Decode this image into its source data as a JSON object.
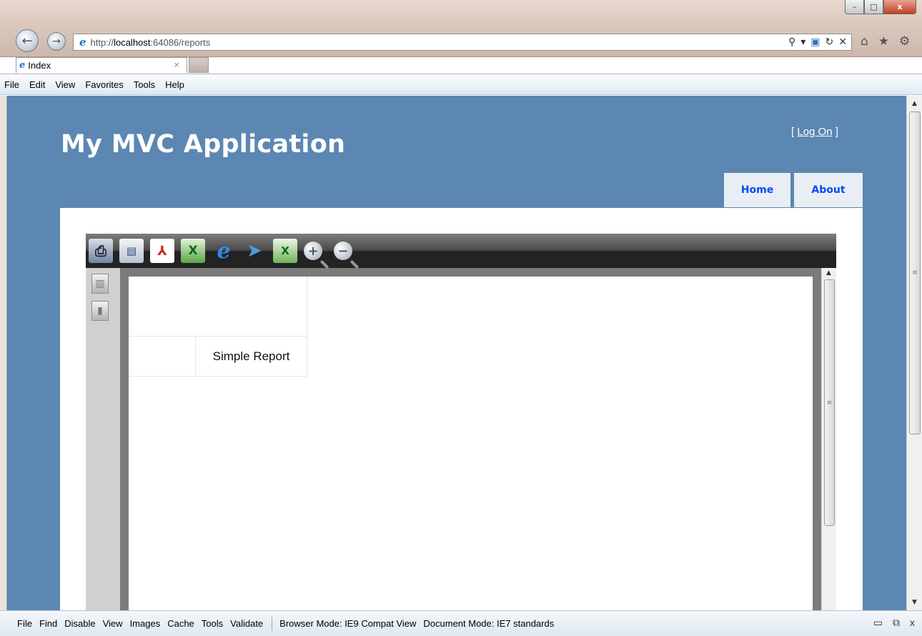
{
  "browser": {
    "url_prefix": "http://",
    "url_host": "localhost",
    "url_rest": ":64086/reports",
    "tab_title": "Index",
    "win_min": "–",
    "win_max": "□",
    "win_close": "x"
  },
  "menubar": {
    "items": [
      "File",
      "Edit",
      "View",
      "Favorites",
      "Tools",
      "Help"
    ]
  },
  "site": {
    "title": "My MVC Application",
    "logon_open": "[",
    "logon_label": "Log On",
    "logon_close": "]",
    "nav": [
      {
        "label": "Home"
      },
      {
        "label": "About"
      }
    ]
  },
  "report": {
    "title": "Simple Report",
    "toolbar_icons": [
      "print-icon",
      "document-icon",
      "pdf-icon",
      "excel-icon",
      "ie-icon",
      "send-icon",
      "excel-export-icon",
      "zoom-in-icon",
      "zoom-out-icon"
    ]
  },
  "devtools": {
    "items": [
      "File",
      "Find",
      "Disable",
      "View",
      "Images",
      "Cache",
      "Tools",
      "Validate"
    ],
    "browser_mode": "Browser Mode: IE9 Compat View",
    "document_mode": "Document Mode: IE7 standards"
  },
  "colors": {
    "site_background": "#5c87b2",
    "nav_tab_background": "#e8eef4",
    "nav_tab_text": "#034af3"
  }
}
